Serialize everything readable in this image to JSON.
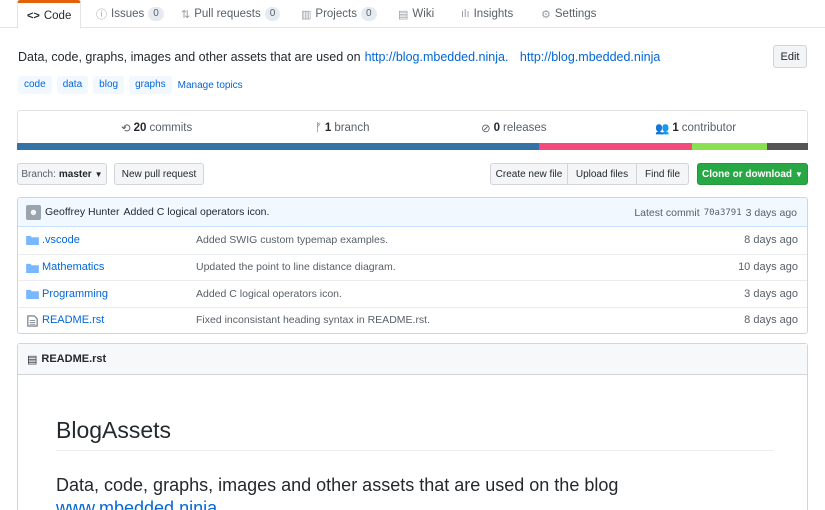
{
  "tabs": [
    {
      "icon": "<>",
      "label": "Code"
    },
    {
      "icon": "ⓘ",
      "label": "Issues",
      "count": "0"
    },
    {
      "icon": "⇅",
      "label": "Pull requests",
      "count": "0"
    },
    {
      "icon": "▥",
      "label": "Projects",
      "count": "0"
    },
    {
      "icon": "▤",
      "label": "Wiki"
    },
    {
      "icon": "ılı",
      "label": "Insights"
    },
    {
      "icon": "⚙",
      "label": "Settings"
    }
  ],
  "repo": {
    "description": "Data, code, graphs, images and other assets that are used on",
    "link": "http://blog.mbedded.ninja.",
    "website": "http://blog.mbedded.ninja",
    "edit_label": "Edit",
    "topics": [
      "code",
      "data",
      "blog",
      "graphs"
    ],
    "manage_topics": "Manage topics"
  },
  "summary": {
    "commits_count": "20",
    "commits_label": "commits",
    "branch_count": "1",
    "branch_label": "branch",
    "releases_count": "0",
    "releases_label": "releases",
    "contributors_count": "1",
    "contributors_label": "contributor"
  },
  "languages": [
    {
      "color": "#3572A5",
      "percent": 66.0
    },
    {
      "color": "#f34b7d",
      "percent": 19.3
    },
    {
      "color": "#89e051",
      "percent": 9.5
    },
    {
      "color": "#555555",
      "percent": 5.2
    }
  ],
  "toolbar": {
    "branch_label": "Branch:",
    "branch_name": "master",
    "new_pr": "New pull request",
    "create_file": "Create new file",
    "upload_files": "Upload files",
    "find_file": "Find file",
    "clone": "Clone or download"
  },
  "commit": {
    "author": "Geoffrey Hunter",
    "message": "Added C logical operators icon.",
    "latest_label": "Latest commit",
    "sha": "70a3791",
    "age": "3 days ago"
  },
  "files": [
    {
      "name": ".vscode",
      "type": "folder",
      "message": "Added SWIG custom typemap examples.",
      "age": "8 days ago"
    },
    {
      "name": "Mathematics",
      "type": "folder",
      "message": "Updated the point to line distance diagram.",
      "age": "10 days ago"
    },
    {
      "name": "Programming",
      "type": "folder",
      "message": "Added C logical operators icon.",
      "age": "3 days ago"
    },
    {
      "name": "README.rst",
      "type": "file",
      "message": "Fixed inconsistant heading syntax in README.rst.",
      "age": "8 days ago"
    }
  ],
  "readme": {
    "filename": "README.rst",
    "title": "BlogAssets",
    "subtitle": "Data, code, graphs, images and other assets that are used on the blog",
    "subtitle_link": "www.mbedded.ninja"
  },
  "colors": {
    "accent": "#e36209",
    "link": "#0366d6",
    "clone_button": "#28a745"
  }
}
